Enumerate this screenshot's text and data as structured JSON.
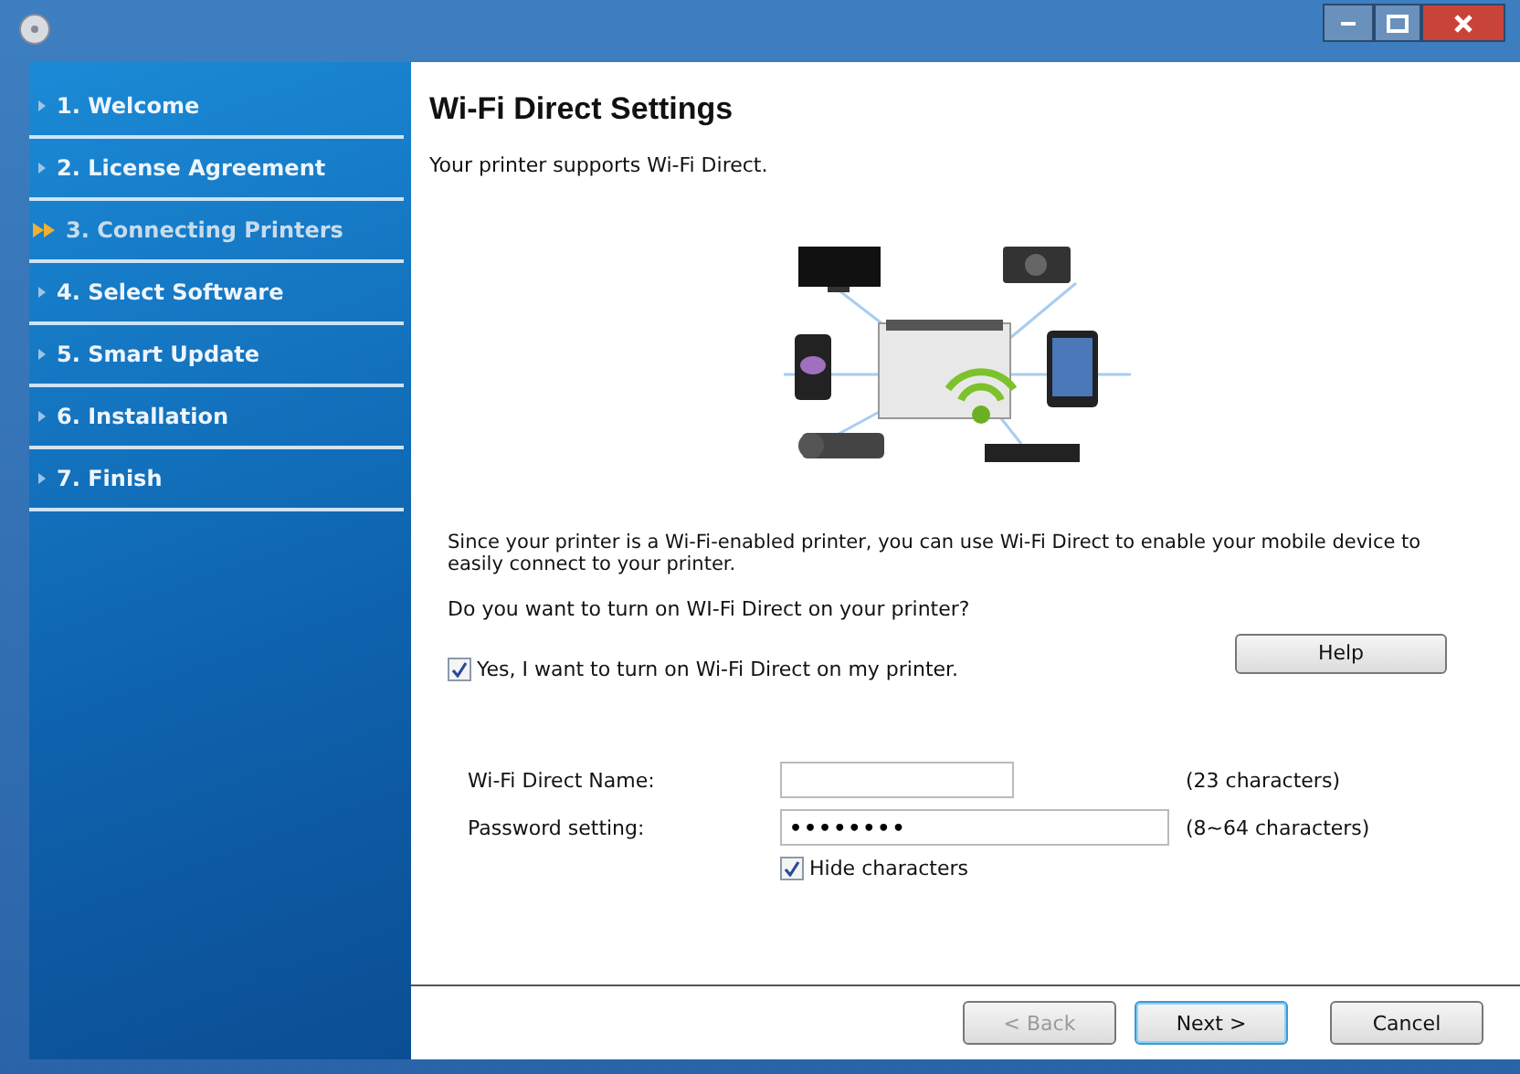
{
  "steps": [
    {
      "label": "1. Welcome",
      "selected": false
    },
    {
      "label": "2. License Agreement",
      "selected": false
    },
    {
      "label": "3. Connecting Printers",
      "selected": true
    },
    {
      "label": "4. Select Software",
      "selected": false
    },
    {
      "label": "5. Smart Update",
      "selected": false
    },
    {
      "label": "6. Installation",
      "selected": false
    },
    {
      "label": "7. Finish",
      "selected": false
    }
  ],
  "heading": "Wi-Fi Direct Settings",
  "subtitle": "Your printer supports Wi-Fi Direct.",
  "description": "Since your printer is a Wi-Fi-enabled printer, you can use Wi-Fi Direct to enable your mobile device to easily connect to your printer.",
  "question": "Do you want to turn on WI-Fi Direct on your printer?",
  "enable_checkbox": {
    "label": "Yes, I want to turn on Wi-Fi Direct on my printer.",
    "checked": true
  },
  "help_button": "Help",
  "fields": [
    {
      "label": "Wi-Fi Direct Name:",
      "hint": "(23 characters)"
    },
    {
      "label": "Password setting:",
      "value": "••••••••",
      "hint": "(8~64 characters)"
    }
  ],
  "hide_checkbox": {
    "label": "Hide characters",
    "checked": true
  },
  "buttons": [
    {
      "label": "< Back",
      "disabled": true,
      "default": false
    },
    {
      "label": "Next >",
      "disabled": false,
      "default": true
    },
    {
      "label": "Cancel",
      "disabled": false,
      "default": false
    }
  ]
}
